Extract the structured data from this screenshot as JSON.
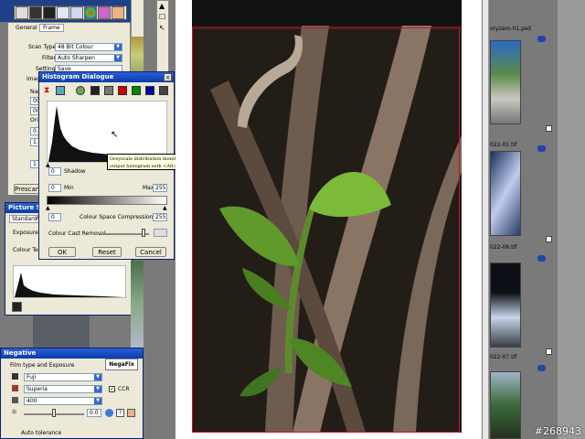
{
  "colors": {
    "accent": "#0a3ca8",
    "frame_red": "#d01020",
    "preview_bg": "#111111"
  },
  "frame_panel": {
    "tabs": [
      "General",
      "Frame"
    ],
    "scan_type_label": "Scan Type",
    "scan_type_value": "48 Bit Colour",
    "filter_label": "Filter",
    "filter_value": "Auto Sharpen",
    "setting_label": "Setting",
    "setting_value": "Save",
    "image_label": "Image",
    "name_label": "Nar",
    "name_value_1": "007",
    "name_value_2": "007",
    "orig_label": "Orig",
    "val_09": "0.9",
    "val_14": "1.4",
    "val_15": "1.5",
    "prescan_label": "Prescan"
  },
  "histogram": {
    "title": "Histogram Dialogue",
    "shadow_label": "Shadow",
    "shadow_value": "0",
    "min_label": "Min",
    "min_value": "0",
    "max_label": "Max",
    "max_value": "255",
    "compression_label": "Colour Space Compression",
    "compression_left": "0",
    "compression_right": "255",
    "cast_label": "Colour Cast Removal",
    "ok_label": "OK",
    "reset_label": "Reset",
    "cancel_label": "Cancel",
    "tooltip_line1": "Greyscale distribution monitor. Display",
    "tooltip_line2": "output histogram with <Alt>"
  },
  "picture_settings": {
    "title": "Picture Settin",
    "tab_standard": "Standard",
    "tab_a": "A",
    "exposure_label": "Exposure",
    "colour_temp_label": "Colour Tem"
  },
  "negative": {
    "title": "Negative",
    "section_label": "Film type and Exposure",
    "logo": "NegaFix",
    "maker_value": "Fuji",
    "film_value": "Superia",
    "iso_value": "400",
    "ccr_label": "CCR",
    "exposure_value": "0.0",
    "auto_tolerance_label": "Auto tolerance"
  },
  "thumbnails": {
    "file1": "oryzam-01.psd",
    "file2": "022-01.tif",
    "file3": "022-06.tif",
    "file4": "022-07.tif"
  },
  "watermark": "#268943"
}
